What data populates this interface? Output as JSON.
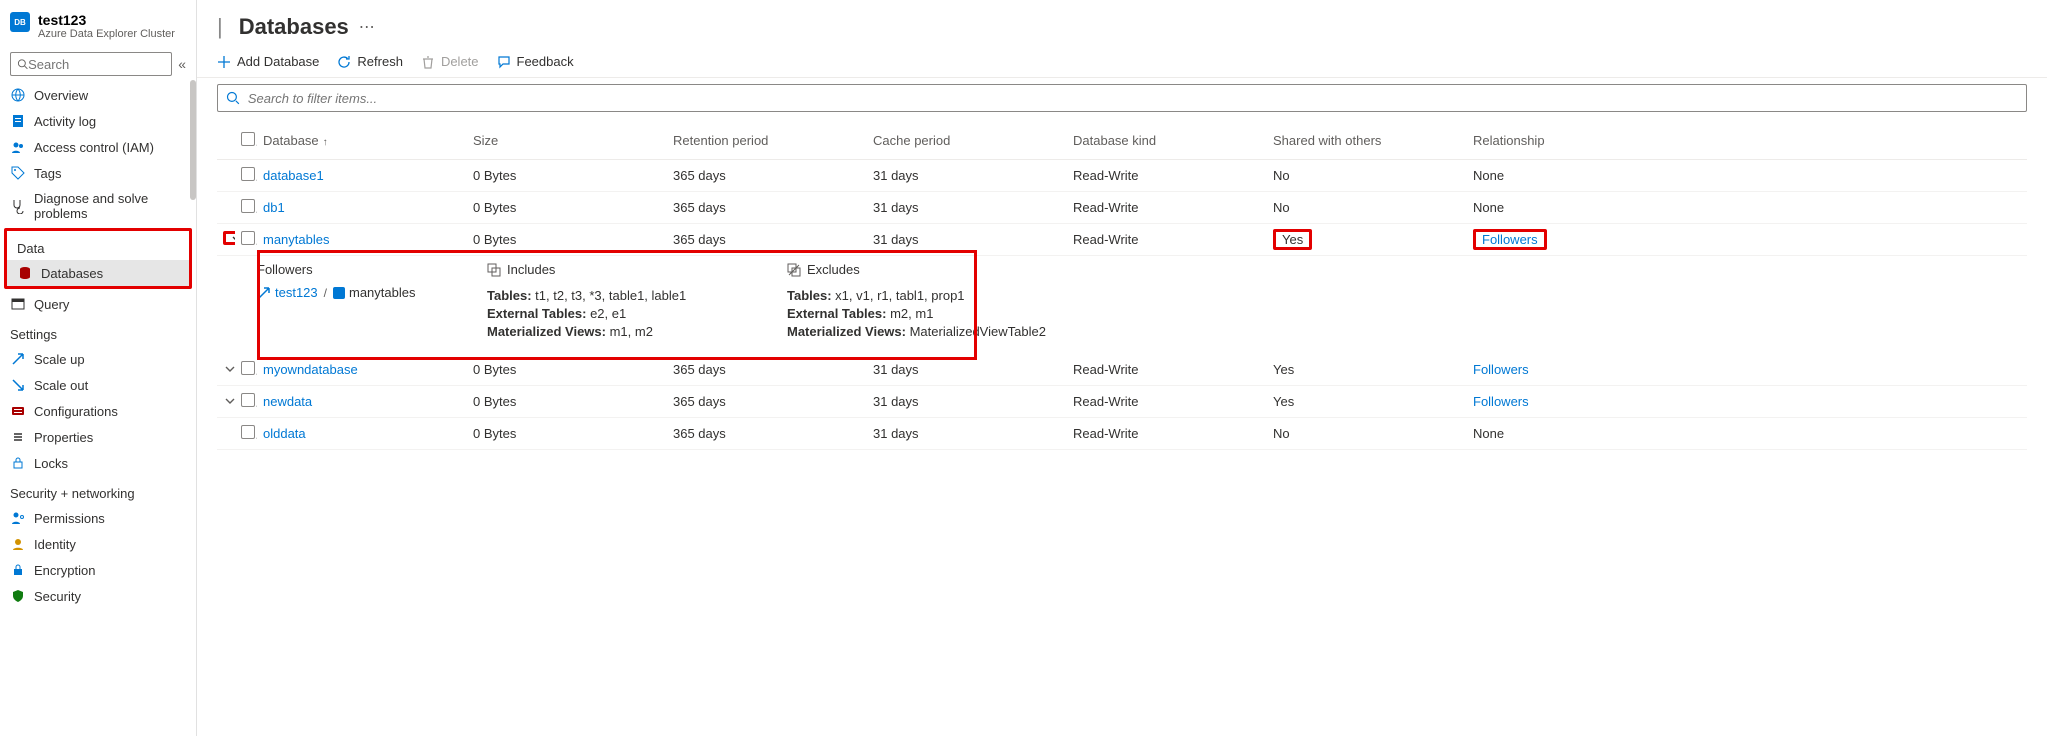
{
  "header": {
    "cluster_name": "test123",
    "cluster_type": "Azure Data Explorer Cluster",
    "page_title": "Databases"
  },
  "sidebar": {
    "search_placeholder": "Search",
    "groups": {
      "top": [
        {
          "label": "Overview",
          "icon": "globe",
          "color": "#0078d4"
        },
        {
          "label": "Activity log",
          "icon": "log",
          "color": "#0078d4"
        },
        {
          "label": "Access control (IAM)",
          "icon": "people",
          "color": "#0078d4"
        },
        {
          "label": "Tags",
          "icon": "tag",
          "color": "#0078d4"
        },
        {
          "label": "Diagnose and solve problems",
          "icon": "stetho",
          "color": "#323130"
        }
      ],
      "data_label": "Data",
      "data": [
        {
          "label": "Databases",
          "icon": "db",
          "color": "#a80000",
          "selected": true
        },
        {
          "label": "Query",
          "icon": "query",
          "color": "#323130"
        }
      ],
      "settings_label": "Settings",
      "settings": [
        {
          "label": "Scale up",
          "icon": "scaleup",
          "color": "#0078d4"
        },
        {
          "label": "Scale out",
          "icon": "scaleout",
          "color": "#0078d4"
        },
        {
          "label": "Configurations",
          "icon": "config",
          "color": "#a80000"
        },
        {
          "label": "Properties",
          "icon": "props",
          "color": "#323130"
        },
        {
          "label": "Locks",
          "icon": "lock",
          "color": "#0078d4"
        }
      ],
      "secnet_label": "Security + networking",
      "secnet": [
        {
          "label": "Permissions",
          "icon": "perm",
          "color": "#0078d4"
        },
        {
          "label": "Identity",
          "icon": "id",
          "color": "#d29200"
        },
        {
          "label": "Encryption",
          "icon": "enc",
          "color": "#0078d4"
        },
        {
          "label": "Security",
          "icon": "shield",
          "color": "#107c10"
        }
      ]
    }
  },
  "toolbar": {
    "add_label": "Add Database",
    "refresh_label": "Refresh",
    "delete_label": "Delete",
    "feedback_label": "Feedback"
  },
  "filter": {
    "placeholder": "Search to filter items..."
  },
  "columns": {
    "c0": "Database",
    "c1": "Size",
    "c2": "Retention period",
    "c3": "Cache period",
    "c4": "Database kind",
    "c5": "Shared with others",
    "c6": "Relationship"
  },
  "rows": [
    {
      "name": "database1",
      "size": "0 Bytes",
      "ret": "365 days",
      "cache": "31 days",
      "kind": "Read-Write",
      "shared": "No",
      "rel": "None",
      "rel_link": false,
      "expand": "none",
      "shared_hl": false,
      "rel_hl": false
    },
    {
      "name": "db1",
      "size": "0 Bytes",
      "ret": "365 days",
      "cache": "31 days",
      "kind": "Read-Write",
      "shared": "No",
      "rel": "None",
      "rel_link": false,
      "expand": "none",
      "shared_hl": false,
      "rel_hl": false
    },
    {
      "name": "manytables",
      "size": "0 Bytes",
      "ret": "365 days",
      "cache": "31 days",
      "kind": "Read-Write",
      "shared": "Yes",
      "rel": "Followers",
      "rel_link": true,
      "expand": "open",
      "shared_hl": true,
      "rel_hl": true
    },
    {
      "name": "myowndatabase",
      "size": "0 Bytes",
      "ret": "365 days",
      "cache": "31 days",
      "kind": "Read-Write",
      "shared": "Yes",
      "rel": "Followers",
      "rel_link": true,
      "expand": "closed",
      "shared_hl": false,
      "rel_hl": false
    },
    {
      "name": "newdata",
      "size": "0 Bytes",
      "ret": "365 days",
      "cache": "31 days",
      "kind": "Read-Write",
      "shared": "Yes",
      "rel": "Followers",
      "rel_link": true,
      "expand": "closed",
      "shared_hl": false,
      "rel_hl": false
    },
    {
      "name": "olddata",
      "size": "0 Bytes",
      "ret": "365 days",
      "cache": "31 days",
      "kind": "Read-Write",
      "shared": "No",
      "rel": "None",
      "rel_link": false,
      "expand": "none",
      "shared_hl": false,
      "rel_hl": false
    }
  ],
  "expand": {
    "followers_h": "Followers",
    "includes_h": "Includes",
    "excludes_h": "Excludes",
    "follower_cluster": "test123",
    "follower_slash": "/",
    "follower_db": "manytables",
    "inc_tables_k": "Tables:",
    "inc_tables_v": "t1, t2, t3, *3, table1, lable1",
    "inc_ext_k": "External Tables:",
    "inc_ext_v": "e2, e1",
    "inc_mat_k": "Materialized Views:",
    "inc_mat_v": "m1, m2",
    "exc_tables_k": "Tables:",
    "exc_tables_v": "x1, v1, r1, tabl1, prop1",
    "exc_ext_k": "External Tables:",
    "exc_ext_v": "m2, m1",
    "exc_mat_k": "Materialized Views:",
    "exc_mat_v": "MaterializedViewTable2"
  }
}
